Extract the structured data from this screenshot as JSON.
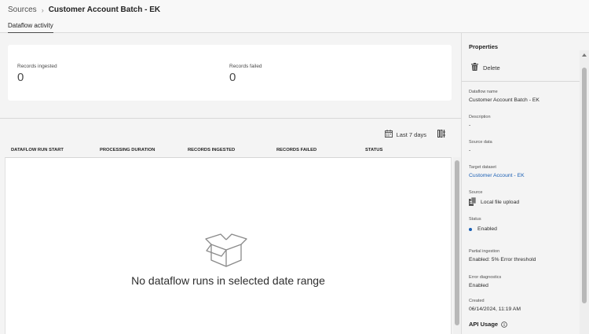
{
  "breadcrumb": {
    "root": "Sources",
    "separator": "›",
    "current": "Customer Account Batch - EK"
  },
  "tabs": {
    "active": "Dataflow activity"
  },
  "metrics": {
    "ingested_label": "Records ingested",
    "ingested_value": "0",
    "failed_label": "Records failed",
    "failed_value": "0"
  },
  "toolbar": {
    "date_filter": "Last 7 days",
    "calendar_icon": "calendar-icon",
    "columns_icon": "column-settings-icon"
  },
  "table": {
    "columns": [
      "DATAFLOW RUN START",
      "PROCESSING DURATION",
      "RECORDS INGESTED",
      "RECORDS FAILED",
      "STATUS"
    ],
    "empty_message": "No dataflow runs in selected date range",
    "empty_icon": "empty-box-icon"
  },
  "properties": {
    "title": "Properties",
    "delete_label": "Delete",
    "dataflow_name_label": "Dataflow name",
    "dataflow_name": "Customer Account Batch - EK",
    "description_label": "Description",
    "description": "-",
    "source_data_label": "Source data",
    "source_data": "-",
    "target_dataset_label": "Target dataset",
    "target_dataset": "Customer Account - EK",
    "source_label": "Source",
    "source": "Local file upload",
    "status_label": "Status",
    "status": "Enabled",
    "partial_label": "Partial ingestion",
    "partial": "Enabled: 5% Error threshold",
    "error_diag_label": "Error diagnostics",
    "error_diag": "Enabled",
    "created_label": "Created",
    "created": "06/14/2024, 11:19 AM",
    "api_usage_label": "API Usage"
  },
  "colors": {
    "accent_link": "#1a5fb4",
    "status_dot": "#1a5fb4"
  }
}
